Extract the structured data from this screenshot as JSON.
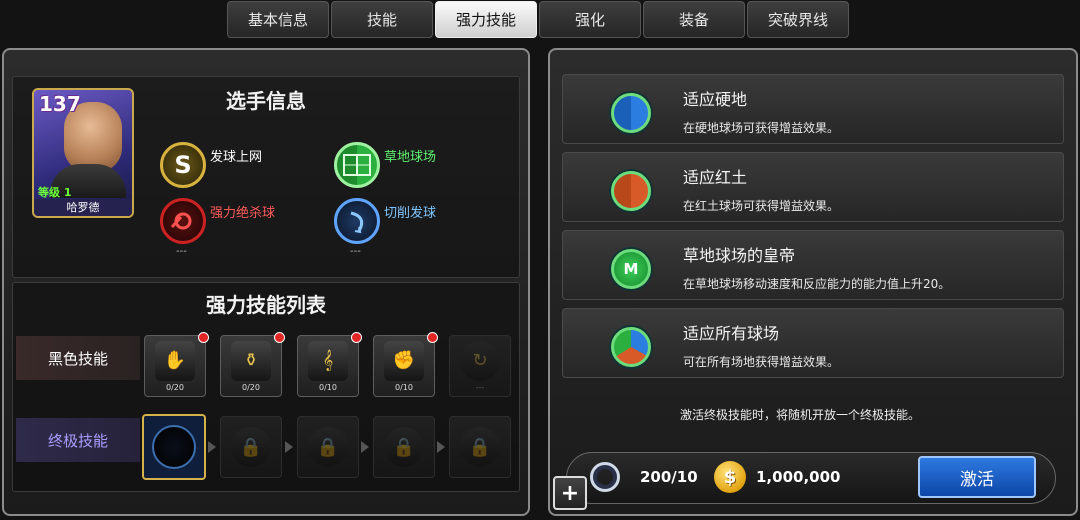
{
  "tabs": [
    {
      "label": "基本信息",
      "active": false
    },
    {
      "label": "技能",
      "active": false
    },
    {
      "label": "强力技能",
      "active": true
    },
    {
      "label": "强化",
      "active": false
    },
    {
      "label": "装备",
      "active": false
    },
    {
      "label": "突破界线",
      "active": false
    }
  ],
  "player_info": {
    "title": "选手信息",
    "card": {
      "level": "137",
      "grade": "等级 1",
      "name": "哈罗德"
    },
    "skills": [
      {
        "icon": "serve-s-icon",
        "glyph": "S",
        "label": "发球上网",
        "color": "#ffffff"
      },
      {
        "icon": "grass-court-icon",
        "glyph": "",
        "label": "草地球场",
        "color": "#5ff06f"
      },
      {
        "icon": "power-kill-shot-icon",
        "glyph": "",
        "label": "强力绝杀球",
        "color": "#ff5a5a",
        "sub": "---"
      },
      {
        "icon": "slice-serve-icon",
        "glyph": "",
        "label": "切削发球",
        "color": "#7ec4ff",
        "sub": "---"
      }
    ]
  },
  "power_skill_list": {
    "title": "强力技能列表",
    "black_label": "黑色技能",
    "ultimate_label": "终极技能",
    "black_slots": [
      {
        "count": "0/20",
        "new": true
      },
      {
        "count": "0/20",
        "new": true
      },
      {
        "count": "0/10",
        "new": true
      },
      {
        "count": "0/10",
        "new": true
      },
      {
        "count": "---",
        "new": false
      }
    ]
  },
  "effects": [
    {
      "title": "适应硬地",
      "desc": "在硬地球场可获得增益效果。",
      "glyph": ""
    },
    {
      "title": "适应红土",
      "desc": "在红土球场可获得增益效果。",
      "glyph": ""
    },
    {
      "title": "草地球场的皇帝",
      "desc": "在草地球场移动速度和反应能力的能力值上升20。",
      "glyph": "M"
    },
    {
      "title": "适应所有球场",
      "desc": "可在所有场地获得增益效果。",
      "glyph": ""
    }
  ],
  "note": "激活终极技能时，将随机开放一个终极技能。",
  "cost": {
    "ring": "200/10",
    "gold": "1,000,000",
    "gold_symbol": "$"
  },
  "activate_label": "激活",
  "plus_label": "+"
}
